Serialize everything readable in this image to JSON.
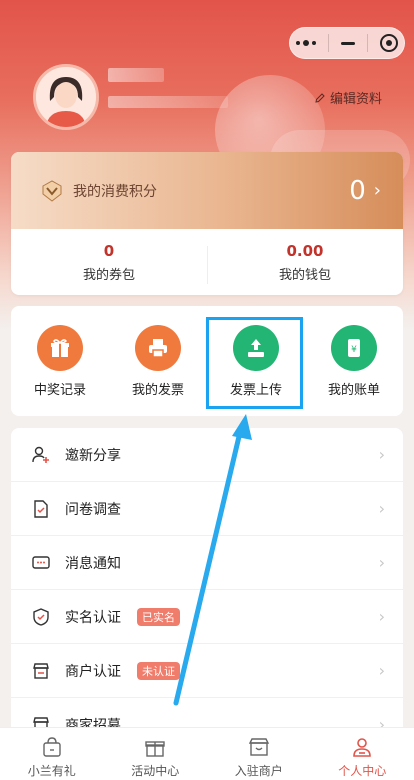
{
  "header": {
    "edit_profile": "编辑资料"
  },
  "points": {
    "label": "我的消费积分",
    "value": "0",
    "arrow": "›"
  },
  "stats": [
    {
      "value": "0",
      "label": "我的券包"
    },
    {
      "value": "0.00",
      "label": "我的钱包"
    }
  ],
  "actions": [
    {
      "label": "中奖记录",
      "icon": "gift-icon",
      "color": "#f07a3e"
    },
    {
      "label": "我的发票",
      "icon": "printer-icon",
      "color": "#f07a3e"
    },
    {
      "label": "发票上传",
      "icon": "upload-icon",
      "color": "#22b573"
    },
    {
      "label": "我的账单",
      "icon": "bill-icon",
      "color": "#22b573"
    }
  ],
  "menu": [
    {
      "label": "邀新分享",
      "icon": "user-plus-icon"
    },
    {
      "label": "问卷调查",
      "icon": "survey-icon"
    },
    {
      "label": "消息通知",
      "icon": "message-icon"
    },
    {
      "label": "实名认证",
      "icon": "shield-icon",
      "tag": "已实名"
    },
    {
      "label": "商户认证",
      "icon": "store-icon",
      "tag": "未认证"
    },
    {
      "label": "商家招募",
      "icon": "shop-icon"
    }
  ],
  "tabs": [
    {
      "label": "小兰有礼",
      "icon": "bag-icon"
    },
    {
      "label": "活动中心",
      "icon": "gift-icon"
    },
    {
      "label": "入驻商户",
      "icon": "store-icon"
    },
    {
      "label": "个人中心",
      "icon": "person-icon",
      "active": true
    }
  ],
  "colors": {
    "brand_red": "#e2544a",
    "highlight_blue": "#1aa3f0",
    "orange": "#f07a3e",
    "green": "#22b573"
  }
}
